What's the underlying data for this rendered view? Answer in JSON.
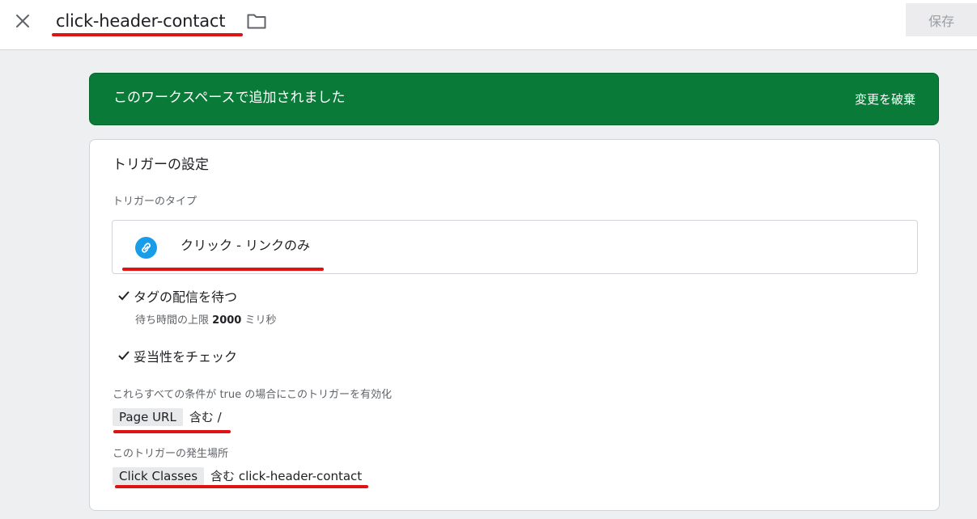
{
  "header": {
    "title": "click-header-contact",
    "save_label": "保存"
  },
  "banner": {
    "message": "このワークスペースで追加されました",
    "discard_label": "変更を破棄",
    "color": "#0a7a38"
  },
  "trigger": {
    "section_title": "トリガーの設定",
    "type_label": "トリガーのタイプ",
    "type_value": "クリック - リンクのみ",
    "type_icon": "link-icon",
    "options": [
      {
        "label": "タグの配信を待つ",
        "checked": true
      },
      {
        "label": "妥当性をチェック",
        "checked": true
      }
    ],
    "wait_note_prefix": "待ち時間の上限",
    "wait_value": "2000",
    "wait_note_suffix": "ミリ秒",
    "conditions_label": "これらすべての条件が true の場合にこのトリガーを有効化",
    "condition": {
      "variable": "Page URL",
      "operator": "含む",
      "value": "/"
    },
    "fire_on_label": "このトリガーの発生場所",
    "fire_on": {
      "variable": "Click Classes",
      "operator": "含む",
      "value": "click-header-contact"
    }
  },
  "annotation_color": "#e01313"
}
